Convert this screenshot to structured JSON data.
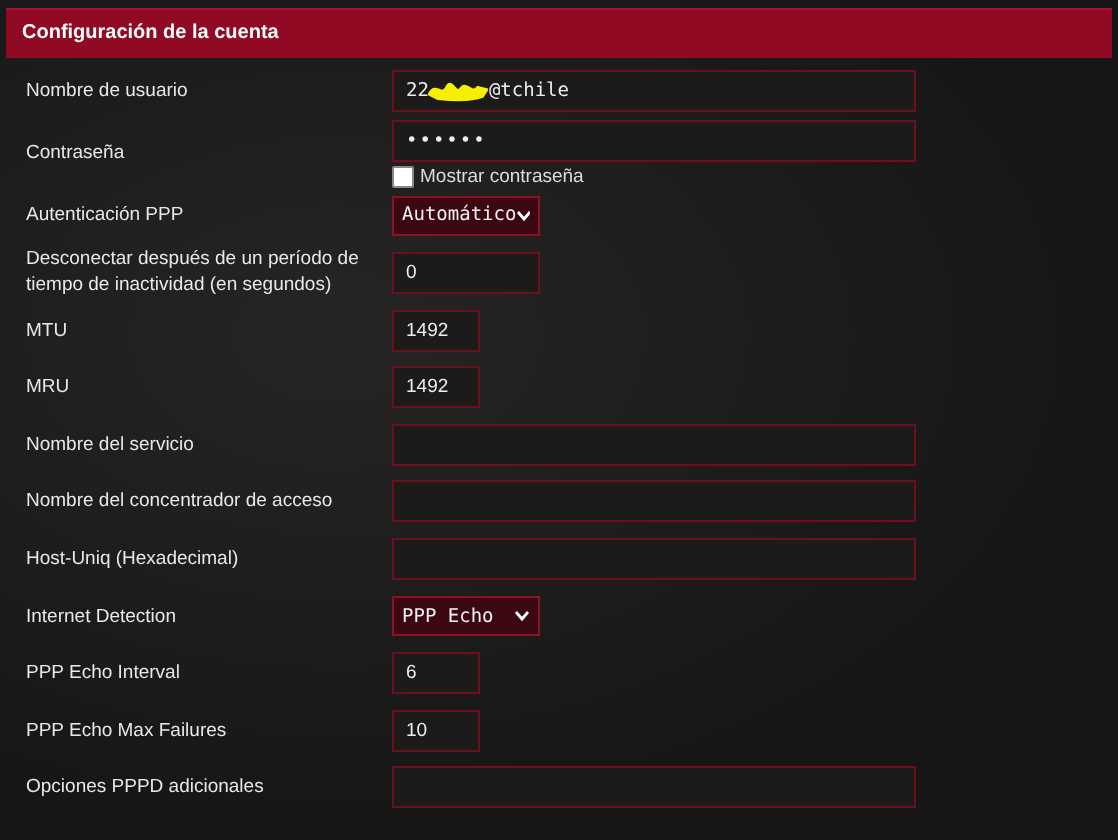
{
  "panel": {
    "title": "Configuración de la cuenta"
  },
  "rows": [
    {
      "label": "Nombre de usuario",
      "kind": "redacted",
      "value_start": "22",
      "value_end": "@tchile"
    },
    {
      "label": "Contraseña",
      "kind": "password",
      "value": "••••••",
      "show_password": {
        "label": "Mostrar contraseña",
        "checked": false
      }
    },
    {
      "label": "Autenticación PPP",
      "kind": "select",
      "value": "Automático"
    },
    {
      "label": "Desconectar después de un período de tiempo de inactividad (en segundos)",
      "kind": "short",
      "value": "0"
    },
    {
      "label": "MTU",
      "kind": "tiny",
      "value": "1492"
    },
    {
      "label": "MRU",
      "kind": "tiny",
      "value": "1492"
    },
    {
      "label": "Nombre del servicio",
      "kind": "text"
    },
    {
      "label": "Nombre del concentrador de acceso",
      "kind": "text"
    },
    {
      "label": "Host-Uniq (Hexadecimal)",
      "kind": "text"
    },
    {
      "label": "Internet Detection",
      "kind": "select",
      "value": "PPP Echo"
    },
    {
      "label": "PPP Echo Interval",
      "kind": "tiny",
      "value": "6"
    },
    {
      "label": "PPP Echo Max Failures",
      "kind": "tiny",
      "value": "10"
    },
    {
      "label": "Opciones PPPD adicionales",
      "kind": "text"
    }
  ]
}
